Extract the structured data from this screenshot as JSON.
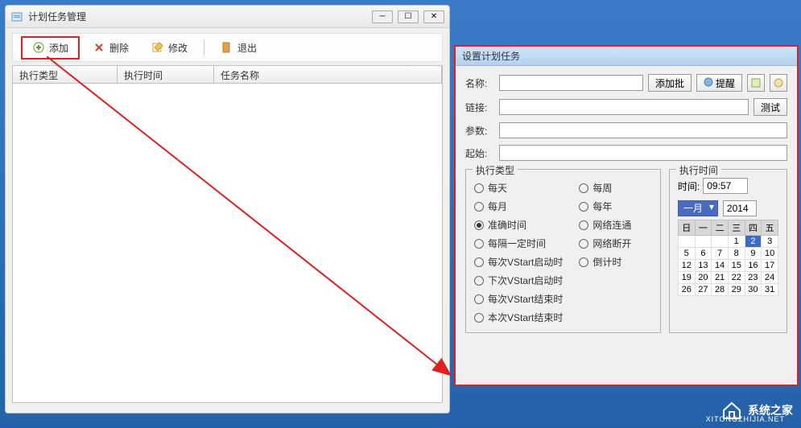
{
  "leftWindow": {
    "title": "计划任务管理",
    "toolbar": {
      "add": "添加",
      "delete": "删除",
      "modify": "修改",
      "exit": "退出"
    },
    "table": {
      "headers": [
        "执行类型",
        "执行时间",
        "任务名称"
      ]
    }
  },
  "rightWindow": {
    "title": "设置计划任务",
    "labels": {
      "name": "名称:",
      "link": "链接:",
      "params": "参数:",
      "start": "起始:"
    },
    "buttons": {
      "addBatch": "添加批",
      "remind": "提醒",
      "test": "测试"
    },
    "execType": {
      "title": "执行类型",
      "col1": [
        "每天",
        "每月",
        "准确时间",
        "每隔一定时间",
        "每次VStart启动时",
        "下次VStart启动时",
        "每次VStart结束时",
        "本次VStart结束时"
      ],
      "col2": [
        "每周",
        "每年",
        "网络连通",
        "网络断开",
        "倒计时"
      ],
      "selected": "准确时间"
    },
    "execTime": {
      "title": "执行时间",
      "timeLabel": "时间:",
      "timeValue": "09:57",
      "month": "一月",
      "year": "2014",
      "weekdays": [
        "日",
        "一",
        "二",
        "三",
        "四",
        "五"
      ],
      "days": [
        [
          "",
          "",
          "",
          "1",
          "2",
          "3"
        ],
        [
          "5",
          "6",
          "7",
          "8",
          "9",
          "10"
        ],
        [
          "12",
          "13",
          "14",
          "15",
          "16",
          "17"
        ],
        [
          "19",
          "20",
          "21",
          "22",
          "23",
          "24"
        ],
        [
          "26",
          "27",
          "28",
          "29",
          "30",
          "31"
        ]
      ],
      "selectedDay": "2"
    }
  },
  "watermark": {
    "text": "系统之家",
    "sub": "XITONGZHIJIA.NET"
  }
}
